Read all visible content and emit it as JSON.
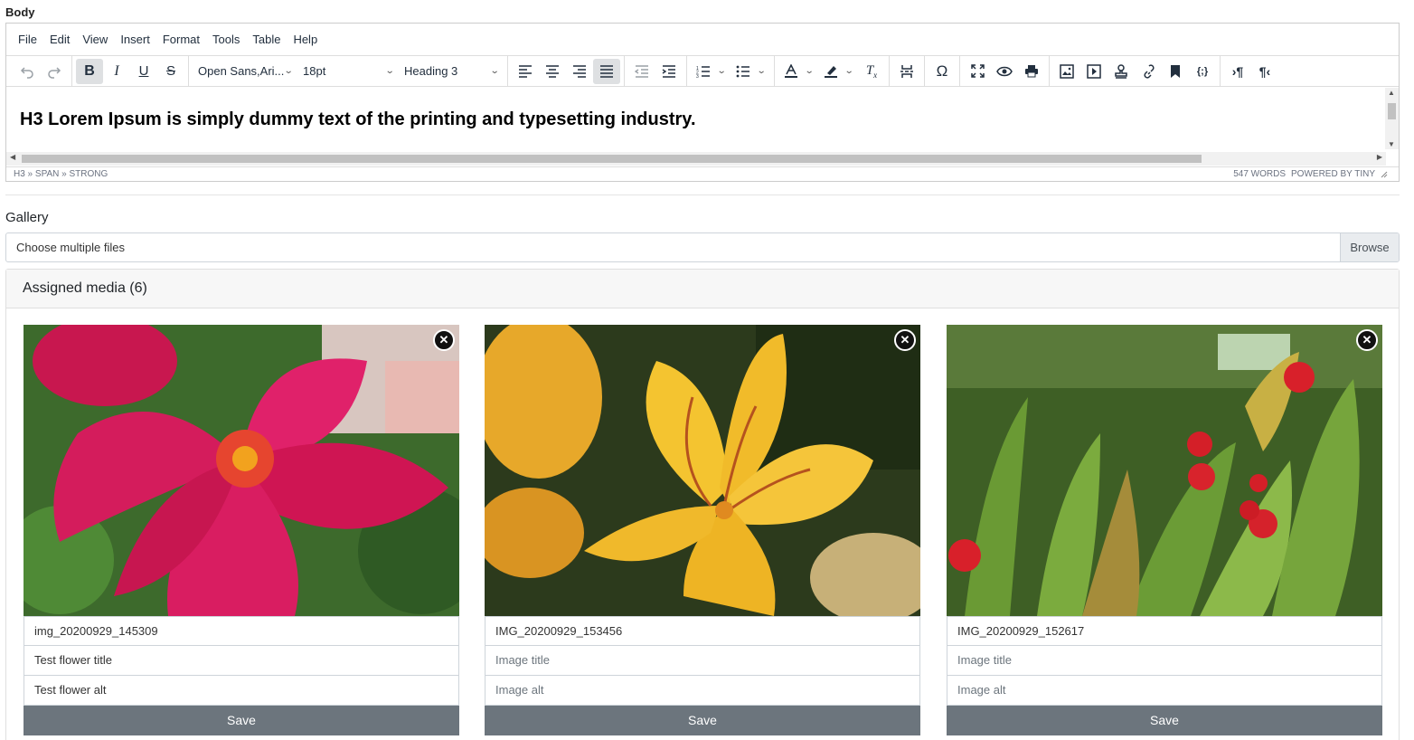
{
  "body_label": "Body",
  "editor": {
    "menu": [
      "File",
      "Edit",
      "View",
      "Insert",
      "Format",
      "Tools",
      "Table",
      "Help"
    ],
    "font_family": "Open Sans,Ari...",
    "font_size": "18pt",
    "block_format": "Heading 3",
    "content_text": "H3 Lorem Ipsum is simply dummy text of the printing and typesetting industry.",
    "path": "H3 » SPAN » STRONG",
    "word_count": "547 WORDS",
    "powered_by": "POWERED BY TINY",
    "toolbar_icons": [
      "undo-icon",
      "redo-icon",
      "bold-icon",
      "italic-icon",
      "underline-icon",
      "strikethrough-icon",
      "align-left-icon",
      "align-center-icon",
      "align-right-icon",
      "align-justify-icon",
      "outdent-icon",
      "indent-icon",
      "numbered-list-icon",
      "bullet-list-icon",
      "text-color-icon",
      "highlight-icon",
      "clear-format-icon",
      "page-break-icon",
      "special-char-icon",
      "fullscreen-icon",
      "preview-icon",
      "print-icon",
      "image-icon",
      "media-icon",
      "stamp-icon",
      "link-icon",
      "bookmark-icon",
      "code-icon",
      "ltr-icon",
      "rtl-icon"
    ]
  },
  "gallery": {
    "label": "Gallery",
    "file_placeholder": "Choose multiple files",
    "browse_label": "Browse"
  },
  "assigned_media": {
    "header": "Assigned media (6)",
    "items": [
      {
        "filename": "img_20200929_145309",
        "title": "Test flower title",
        "alt": "Test flower alt",
        "save_label": "Save",
        "remove_label": "✕"
      },
      {
        "filename": "IMG_20200929_153456",
        "title": "Image title",
        "alt": "Image alt",
        "save_label": "Save",
        "remove_label": "✕"
      },
      {
        "filename": "IMG_20200929_152617",
        "title": "Image title",
        "alt": "Image alt",
        "save_label": "Save",
        "remove_label": "✕"
      }
    ]
  }
}
